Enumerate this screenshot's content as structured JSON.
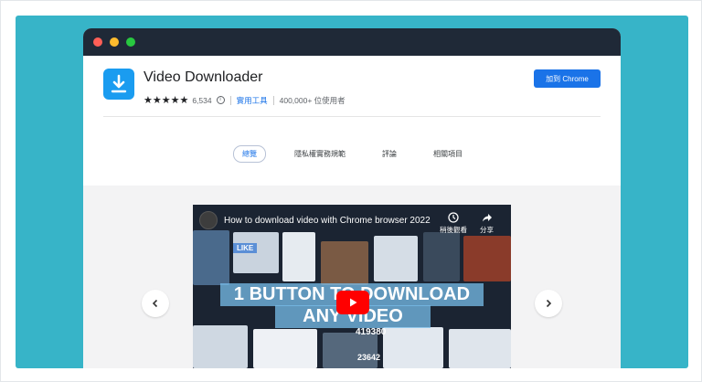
{
  "extension": {
    "title": "Video Downloader",
    "rating_stars": "★★★★★",
    "rating_count": "6,534",
    "category": "實用工具",
    "users": "400,000+ 位使用者",
    "add_button": "加到 Chrome"
  },
  "tabs": [
    {
      "label": "總覽",
      "active": true
    },
    {
      "label": "隱私權實務規範",
      "active": false
    },
    {
      "label": "評論",
      "active": false
    },
    {
      "label": "相關項目",
      "active": false
    }
  ],
  "video": {
    "title": "How to download video with Chrome browser 2022",
    "watch_later": "稍後觀看",
    "share": "分享",
    "headline_line1": "1 BUTTON TO DOWNLOAD",
    "headline_line2": "ANY VIDEO",
    "counter_likes": "LIKE",
    "counter_views": "419380",
    "counter_small": "23642"
  },
  "icons": {
    "extension_icon": "download-arrow-icon",
    "info_icon": "info-icon",
    "prev": "chevron-left-icon",
    "next": "chevron-right-icon",
    "watch_later_icon": "clock-icon",
    "share_icon": "share-arrow-icon",
    "play_icon": "youtube-play-icon"
  },
  "colors": {
    "background": "#37b4c8",
    "titlebar": "#1f2937",
    "accent": "#1a73e8",
    "extension_icon_bg": "#1a9cf0"
  }
}
